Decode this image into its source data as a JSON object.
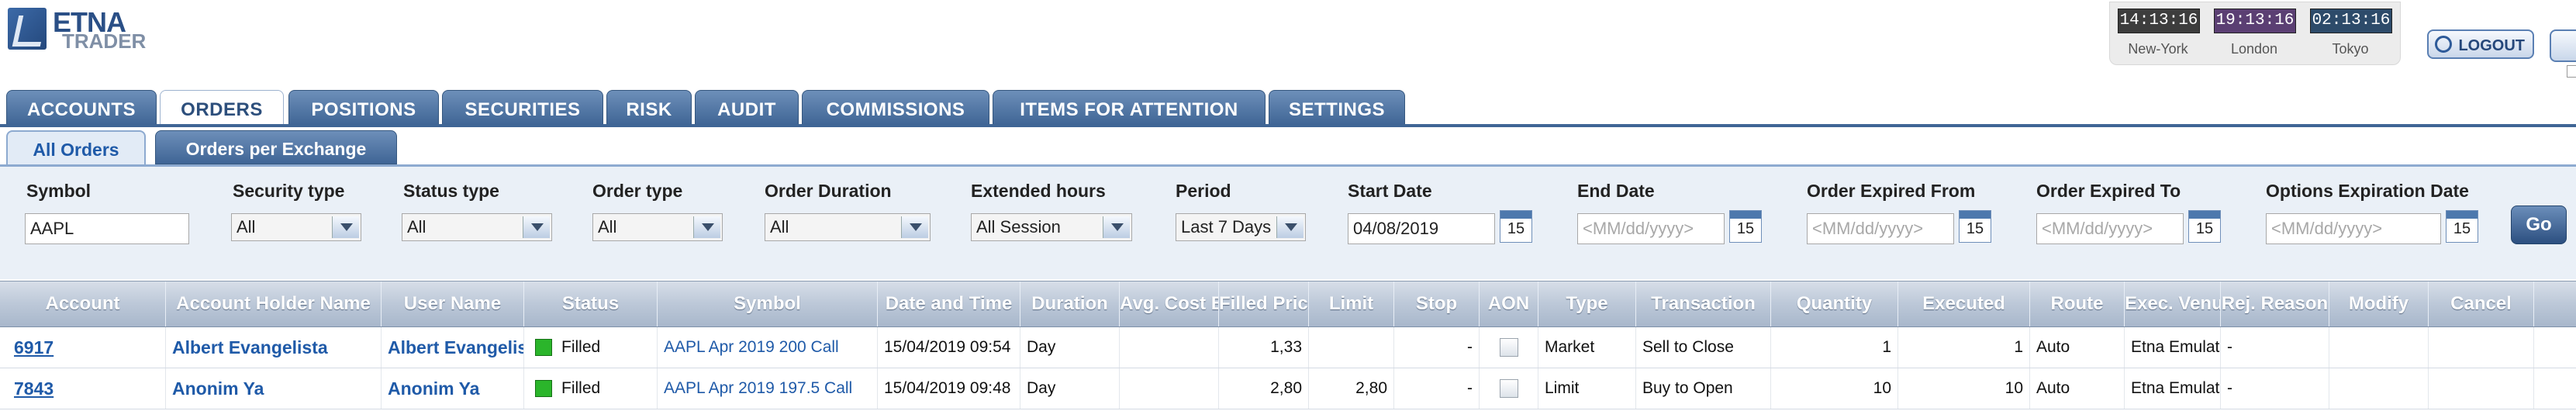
{
  "logo": {
    "line1": "ETNA",
    "line2": "TRADER"
  },
  "clocks": [
    {
      "time": "14:13:16",
      "city": "New-York"
    },
    {
      "time": "19:13:16",
      "city": "London"
    },
    {
      "time": "02:13:16",
      "city": "Tokyo"
    }
  ],
  "logout_label": "LOGOUT",
  "tabs": [
    "ACCOUNTS",
    "ORDERS",
    "POSITIONS",
    "SECURITIES",
    "RISK",
    "AUDIT",
    "COMMISSIONS",
    "ITEMS FOR ATTENTION",
    "SETTINGS"
  ],
  "active_tab": "ORDERS",
  "subtabs": [
    "All Orders",
    "Orders per Exchange"
  ],
  "filters": {
    "symbol_label": "Symbol",
    "symbol_value": "AAPL",
    "security_type_label": "Security type",
    "security_type_value": "All",
    "status_type_label": "Status type",
    "status_type_value": "All",
    "order_type_label": "Order type",
    "order_type_value": "All",
    "order_duration_label": "Order Duration",
    "order_duration_value": "All",
    "extended_hours_label": "Extended hours",
    "extended_hours_value": "All Session",
    "period_label": "Period",
    "period_value": "Last 7 Days",
    "start_date_label": "Start Date",
    "start_date_value": "04/08/2019",
    "end_date_label": "End Date",
    "end_date_placeholder": "<MM/dd/yyyy>",
    "expired_from_label": "Order Expired From",
    "expired_from_placeholder": "<MM/dd/yyyy>",
    "expired_to_label": "Order Expired To",
    "expired_to_placeholder": "<MM/dd/yyyy>",
    "options_exp_label": "Options Expiration Date",
    "options_exp_placeholder": "<MM/dd/yyyy>",
    "calendar_day": "15",
    "go_label": "Go"
  },
  "columns": [
    "Account",
    "Account Holder Name",
    "User Name",
    "Status",
    "Symbol",
    "Date and Time",
    "Duration",
    "Avg. Cost Basis",
    "Filled Price",
    "Limit",
    "Stop",
    "AON",
    "Type",
    "Transaction",
    "Quantity",
    "Executed",
    "Route",
    "Exec. Venue",
    "Rej. Reason",
    "Modify",
    "Cancel"
  ],
  "rows": [
    {
      "account": "6917",
      "holder": "Albert  Evangelista",
      "user": "Albert  Evangelista",
      "status": "Filled",
      "symbol": "AAPL Apr 2019 200 Call",
      "datetime": "15/04/2019 09:54",
      "duration": "Day",
      "avg_cost": "",
      "filled_price": "1,33",
      "limit": "",
      "stop": "-",
      "type": "Market",
      "transaction": "Sell to Close",
      "quantity": "1",
      "executed": "1",
      "route": "Auto",
      "venue": "Etna Emulator",
      "reason": "-"
    },
    {
      "account": "7843",
      "holder": "Anonim  Ya",
      "user": "Anonim  Ya",
      "status": "Filled",
      "symbol": "AAPL Apr 2019 197.5 Call",
      "datetime": "15/04/2019 09:48",
      "duration": "Day",
      "avg_cost": "",
      "filled_price": "2,80",
      "limit": "2,80",
      "stop": "-",
      "type": "Limit",
      "transaction": "Buy to Open",
      "quantity": "10",
      "executed": "10",
      "route": "Auto",
      "venue": "Etna Emulator",
      "reason": "-"
    }
  ]
}
